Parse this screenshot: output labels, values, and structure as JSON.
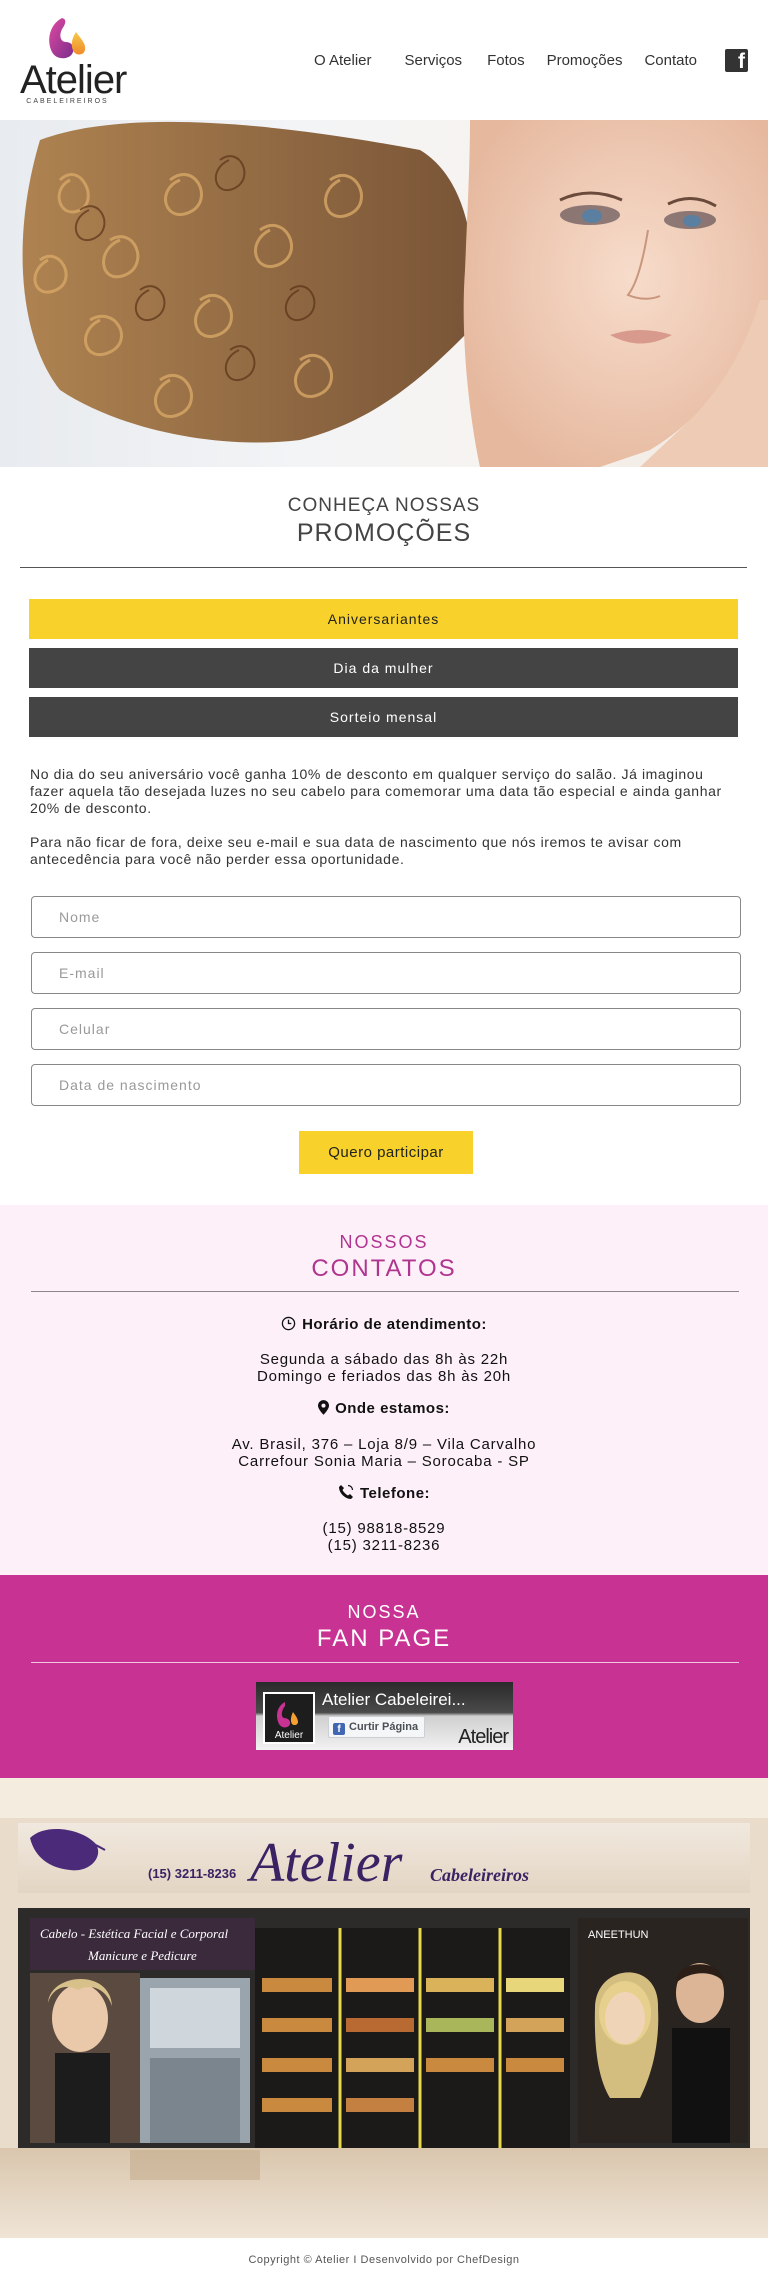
{
  "header": {
    "logo_text": "Atelier",
    "logo_subtext": "CABELEIREIROS",
    "nav": [
      "O Atelier",
      "Serviços",
      "Fotos",
      "Promoções",
      "Contato"
    ],
    "social_icon": "facebook-icon"
  },
  "promo": {
    "heading_small": "CONHEÇA NOSSAS",
    "heading_big": "PROMOÇÕES",
    "tabs": [
      "Aniversariantes",
      "Dia da mulher",
      "Sorteio mensal"
    ],
    "active_tab": "Aniversariantes",
    "paragraph_1": "No dia do seu aniversário você ganha 10% de desconto em qualquer serviço do salão. Já imaginou fazer aquela tão desejada luzes no seu cabelo para comemorar uma data tão especial e ainda ganhar 20% de desconto.",
    "paragraph_2": "Para não ficar de fora, deixe seu e-mail e sua data de nascimento que nós iremos te avisar com antecedência para você não perder essa oportunidade.",
    "form": {
      "name_placeholder": "Nome",
      "email_placeholder": "E-mail",
      "phone_placeholder": "Celular",
      "birth_placeholder": "Data de nascimento",
      "submit_label": "Quero participar"
    }
  },
  "contacts": {
    "heading_small": "NOSSOS",
    "heading_big": "CONTATOS",
    "hours_label": "Horário de atendimento:",
    "hours_line_1": "Segunda a sábado das 8h às 22h",
    "hours_line_2": "Domingo e feriados das 8h às 20h",
    "location_label": "Onde estamos:",
    "address_line_1": "Av. Brasil, 376 – Loja 8/9 – Vila Carvalho",
    "address_line_2": "Carrefour Sonia Maria – Sorocaba - SP",
    "phone_label": "Telefone:",
    "phone_1": "(15) 98818-8529",
    "phone_2": "(15) 3211-8236"
  },
  "fanpage": {
    "heading_small": "NOSSA",
    "heading_big": "FAN PAGE",
    "widget_title": "Atelier Cabeleirei...",
    "widget_like": "Curtir Página",
    "widget_logo": "Atelier"
  },
  "storefront": {
    "sign_phone": "(15) 3211-8236",
    "sign_name": "Atelier",
    "sign_sub": "Cabeleireiros",
    "banner_line_1": "Cabelo - Estética Facial e Corporal",
    "banner_line_2": "Manicure e Pedicure",
    "brand": "ANEETHUN"
  },
  "footer": {
    "text": "Copyright © Atelier I Desenvolvido por ChefDesign"
  },
  "colors": {
    "brand_magenta": "#c83393",
    "accent_yellow": "#f8d22a",
    "tab_dark": "#444444",
    "contacts_bg": "#fdf0f8"
  }
}
